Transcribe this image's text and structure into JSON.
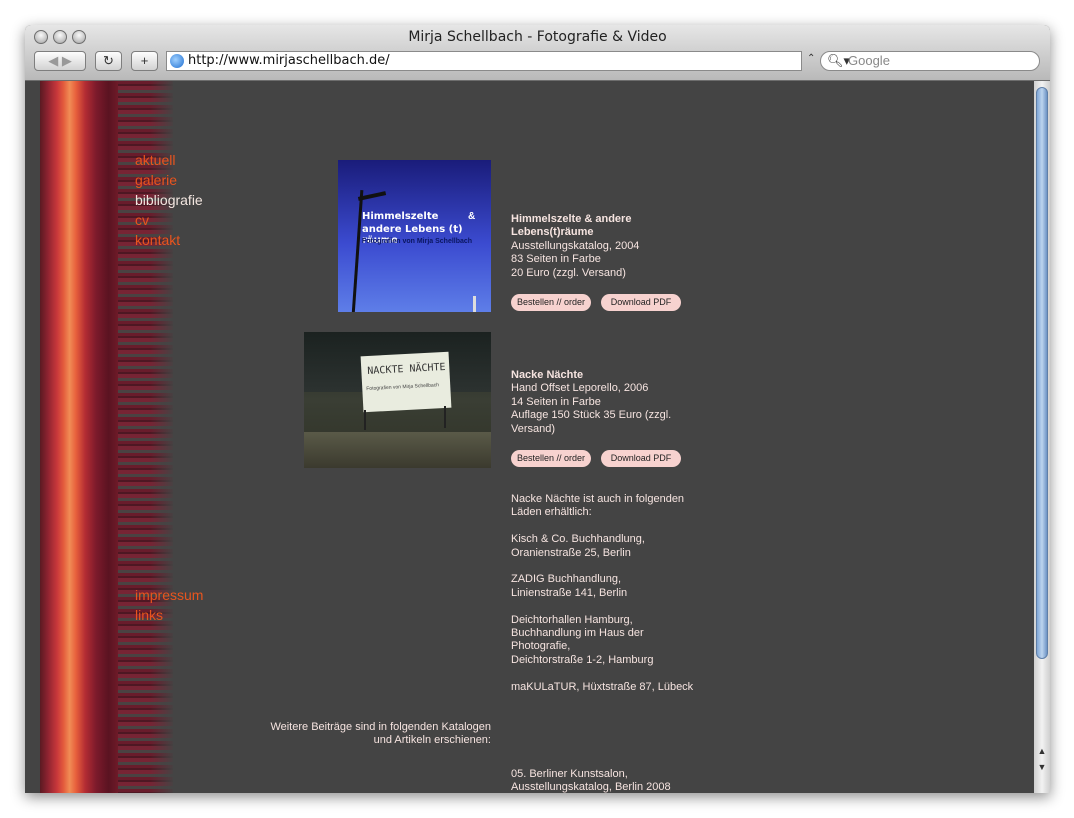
{
  "window": {
    "title": "Mirja Schellbach - Fotografie & Video",
    "url": "http://www.mirjaschellbach.de/",
    "search_placeholder": "Google"
  },
  "nav": {
    "top": [
      {
        "label": "aktuell",
        "active": false
      },
      {
        "label": "galerie",
        "active": false
      },
      {
        "label": "bibliografie",
        "active": true
      },
      {
        "label": "cv",
        "active": false
      },
      {
        "label": "kontakt",
        "active": false
      }
    ],
    "bottom": [
      {
        "label": "impressum"
      },
      {
        "label": "links"
      }
    ]
  },
  "books": [
    {
      "cover_title_line1": "Himmelszelte",
      "cover_amp": "&",
      "cover_title_line2": "andere Lebens (t) räume",
      "cover_subtitle": "Fotografien von Mirja Schellbach",
      "title_line1": "Himmelszelte & andere",
      "title_line2": "Lebens(t)räume",
      "line1": "Ausstellungskatalog, 2004",
      "line2": "83 Seiten in Farbe",
      "line3": "20 Euro (zzgl. Versand)",
      "order_label": "Bestellen // order",
      "pdf_label": "Download PDF"
    },
    {
      "cover_sign_text": "NACKTE NÄCHTE",
      "cover_sign_sub": "Fotografien von Mirja Schellbach",
      "title": "Nacke Nächte",
      "line1": "Hand Offset Leporello, 2006",
      "line2": "14 Seiten in Farbe",
      "line3a": "Auflage 150 Stück 35 Euro (zzgl.",
      "line3b": "Versand)",
      "order_label": "Bestellen // order",
      "pdf_label": "Download PDF"
    }
  ],
  "shops": {
    "intro_a": "Nacke Nächte ist auch in folgenden",
    "intro_b": "Läden erhältlich:",
    "shop1_a": "Kisch & Co. Buchhandlung,",
    "shop1_b": "Oranienstraße 25, Berlin",
    "shop2_a": "ZADIG Buchhandlung,",
    "shop2_b": "Linienstraße 141, Berlin",
    "shop3_a": "Deichtorhallen Hamburg,",
    "shop3_b": "Buchhandlung im Haus der",
    "shop3_c": "Photografie,",
    "shop3_d": "Deichtorstraße 1-2, Hamburg",
    "shop4": "maKULaTUR, Hüxtstraße 87, Lübeck"
  },
  "further": {
    "heading_a": "Weitere Beiträge sind in folgenden Katalogen",
    "heading_b": "und Artikeln erschienen:",
    "entry1_a": "05. Berliner Kunstsalon,",
    "entry1_b": "Ausstellungskatalog, Berlin 2008"
  }
}
